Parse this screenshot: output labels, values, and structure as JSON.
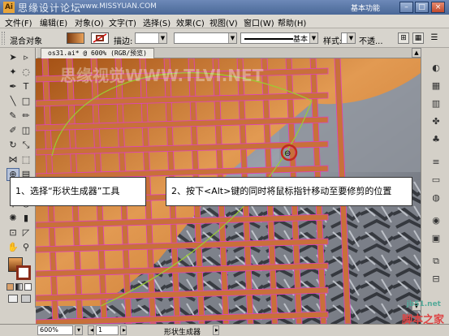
{
  "title_bar": {
    "app_icon": "Ai",
    "watermark": "思缘设计论坛",
    "url": "www.MISSYUAN.COM",
    "workspace": "基本功能",
    "min_icon": "minimize-icon",
    "max_icon": "maximize-icon",
    "close_icon": "close-icon"
  },
  "menu": {
    "items": [
      "文件(F)",
      "编辑(E)",
      "对象(O)",
      "文字(T)",
      "选择(S)",
      "效果(C)",
      "视图(V)",
      "窗口(W)",
      "帮助(H)"
    ]
  },
  "control_bar": {
    "object_label": "混合对象",
    "stroke_label": "描边:",
    "stroke_style": "基本",
    "style_label": "样式:",
    "opacity_label": "不透..."
  },
  "document": {
    "tab_title": "os31.ai* @ 600% (RGB/预览)"
  },
  "canvas": {
    "watermark": "思缘视觉WWW.TLVI.NET"
  },
  "callouts": {
    "first": "1、选择“形状生成器”工具",
    "second": "2、按下<Alt>键的同时将鼠标指针移动至要修剪的位置"
  },
  "status_bar": {
    "zoom": "600%",
    "page": "1",
    "tool_name": "形状生成器"
  },
  "site_watermark": {
    "domain": "jb51.net",
    "name": "脚本之家"
  },
  "colors": {
    "grid_fill": "#c8703a",
    "grid_stroke": "#e040c0",
    "arc": "#9acd32"
  }
}
